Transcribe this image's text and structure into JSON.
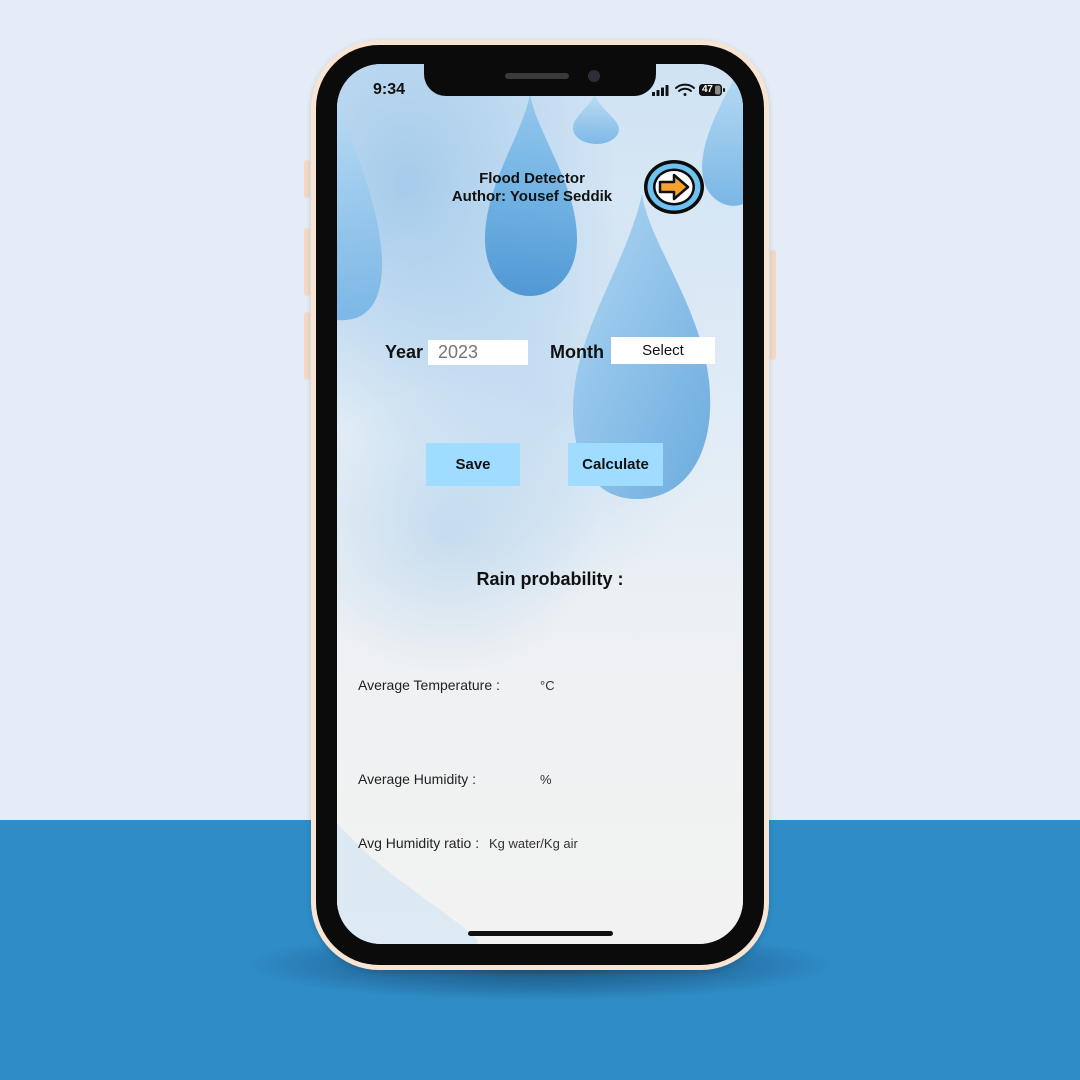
{
  "status_bar": {
    "time": "9:34",
    "battery": "47",
    "icons": [
      "signal-icon",
      "wifi-icon",
      "battery-icon"
    ]
  },
  "header": {
    "title": "Flood Detector",
    "author": "Author: Yousef Seddik",
    "next_icon": "arrow-right-icon"
  },
  "form": {
    "year_label": "Year",
    "year_placeholder": "2023",
    "month_label": "Month",
    "month_selected": "Select"
  },
  "actions": {
    "save_label": "Save",
    "calculate_label": "Calculate"
  },
  "results": {
    "rain_probability_label": "Rain probability :",
    "avg_temperature_label": "Average Temperature :",
    "avg_temperature_unit": "°C",
    "avg_humidity_label": "Average Humidity :",
    "avg_humidity_unit": "%",
    "avg_humidity_ratio_label": "Avg Humidity ratio :",
    "avg_humidity_ratio_unit": "Kg water/Kg air"
  },
  "colors": {
    "background_top": "#e4ecf7",
    "background_floor": "#2f8cc7",
    "phone_frame": "#f8e4d3",
    "button": "#9fdcff",
    "arrow_fill": "#f5a32a",
    "arrow_ring": "#6fc2ef"
  }
}
